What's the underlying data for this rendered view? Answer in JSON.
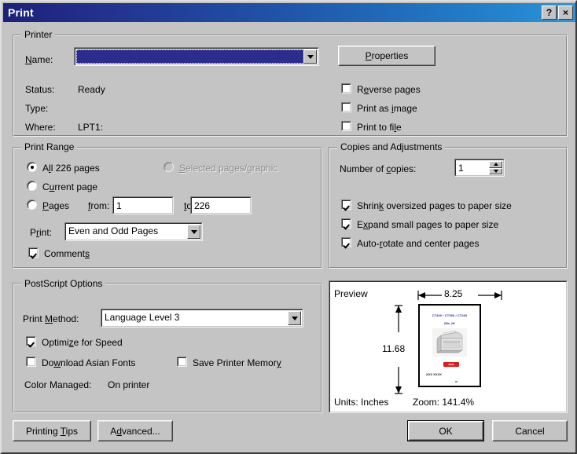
{
  "window": {
    "title": "Print",
    "help_button": "?",
    "close_button": "×"
  },
  "printer": {
    "group_title": "Printer",
    "name_label": "Name:",
    "name_value": "",
    "properties_button": "Properties",
    "status_label": "Status:",
    "status_value": "Ready",
    "type_label": "Type:",
    "type_value": "",
    "where_label": "Where:",
    "where_value": "LPT1:",
    "options": [
      {
        "label_pre": "R",
        "label_accel": "e",
        "label_post": "verse pages",
        "checked": false
      },
      {
        "label_pre": "Print as ",
        "label_accel": "i",
        "label_post": "mage",
        "checked": false
      },
      {
        "label_pre": "Print to fi",
        "label_accel": "l",
        "label_post": "e",
        "checked": false
      }
    ]
  },
  "print_range": {
    "group_title": "Print Range",
    "all_pages_pre": "A",
    "all_pages_accel": "l",
    "all_pages_post": "l 226 pages",
    "all_pages_selected": true,
    "current_page_pre": "C",
    "current_page_accel": "u",
    "current_page_post": "rrent page",
    "current_page_selected": false,
    "pages_pre": "",
    "pages_accel": "P",
    "pages_post": "ages",
    "pages_selected": false,
    "selected_graphic_pre": "",
    "selected_graphic_accel": "S",
    "selected_graphic_post": "elected pages/graphic",
    "selected_graphic_enabled": false,
    "from_label": "from:",
    "from_value": "1",
    "to_label": "to:",
    "to_value": "226",
    "print_label_pre": "P",
    "print_label_accel": "r",
    "print_label_post": "int:",
    "print_value": "Even and Odd Pages",
    "comments_pre": "Comment",
    "comments_accel": "s",
    "comments_post": "",
    "comments_checked": true
  },
  "copies": {
    "group_title": "Copies and Adjustments",
    "number_label_pre": "Number of ",
    "number_label_accel": "c",
    "number_label_post": "opies:",
    "number_value": "1",
    "options": [
      {
        "pre": "Shrin",
        "accel": "k",
        "post": " oversized pages to paper size",
        "checked": true
      },
      {
        "pre": "E",
        "accel": "x",
        "post": "pand small pages to paper size",
        "checked": true
      },
      {
        "pre": "Auto-",
        "accel": "r",
        "post": "otate and center pages",
        "checked": true
      }
    ]
  },
  "postscript": {
    "group_title": "PostScript Options",
    "method_label_pre": "Print ",
    "method_label_accel": "M",
    "method_label_post": "ethod:",
    "method_value": "Language Level 3",
    "optimize_pre": "Optimi",
    "optimize_accel": "z",
    "optimize_post": "e for Speed",
    "optimize_checked": true,
    "download_pre": "Do",
    "download_accel": "w",
    "download_post": "nload Asian Fonts",
    "download_checked": false,
    "savemem_pre": "Save Printer Memor",
    "savemem_accel": "y",
    "savemem_post": "",
    "savemem_checked": false,
    "color_label": "Color Managed:",
    "color_value": "On printer"
  },
  "preview": {
    "label": "Preview",
    "width_dimension": "8.25",
    "height_dimension": "11.68",
    "units_text": "Units: Inches",
    "zoom_text": "Zoom: 141.4%",
    "thumbnail": {
      "header_line1": "CT300 / CT350 / CT400",
      "header_line2": "Win 2K",
      "badge_text": "NEW",
      "footer_text": "XXX XXXX"
    }
  },
  "footer": {
    "printing_tips_pre": "Printing ",
    "printing_tips_accel": "T",
    "printing_tips_post": "ips",
    "advanced_pre": "A",
    "advanced_accel": "d",
    "advanced_post": "vanced...",
    "ok_button": "OK",
    "cancel_button": "Cancel"
  },
  "colors": {
    "title_gradient_start": "#1b2178",
    "title_gradient_end": "#2f93d8",
    "dialog_face": "#c4c4c4",
    "selection_blue": "#2c2c8e",
    "accent_red": "#e21b1b",
    "header_purple": "#2e2e96"
  }
}
